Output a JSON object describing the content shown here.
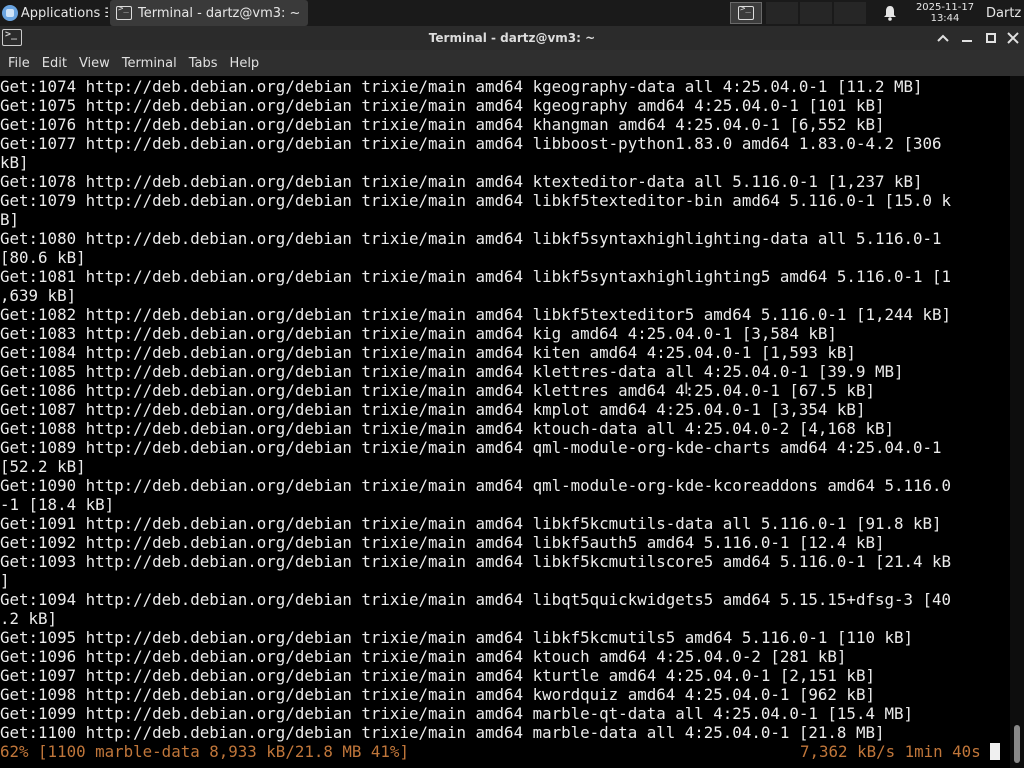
{
  "panel": {
    "apps_label": "Applications ☰",
    "task_label": "Terminal - dartz@vm3: ~",
    "clock_date": "2025-11-17",
    "clock_time": "13:44",
    "user": "Dartz",
    "icons": [
      "applications-icon",
      "terminal-icon",
      "notification-bell-icon"
    ]
  },
  "window": {
    "title": "Terminal - dartz@vm3: ~",
    "controls": [
      "chevron-up-icon",
      "minimize-icon",
      "maximize-icon",
      "close-icon"
    ]
  },
  "menu": [
    {
      "label": "File"
    },
    {
      "label": "Edit"
    },
    {
      "label": "View"
    },
    {
      "label": "Terminal"
    },
    {
      "label": "Tabs"
    },
    {
      "label": "Help"
    }
  ],
  "terminal": {
    "lines": [
      "Get:1074 http://deb.debian.org/debian trixie/main amd64 kgeography-data all 4:25.04.0-1 [11.2 MB]",
      "Get:1075 http://deb.debian.org/debian trixie/main amd64 kgeography amd64 4:25.04.0-1 [101 kB]",
      "Get:1076 http://deb.debian.org/debian trixie/main amd64 khangman amd64 4:25.04.0-1 [6,552 kB]",
      "Get:1077 http://deb.debian.org/debian trixie/main amd64 libboost-python1.83.0 amd64 1.83.0-4.2 [306",
      "kB]",
      "Get:1078 http://deb.debian.org/debian trixie/main amd64 ktexteditor-data all 5.116.0-1 [1,237 kB]",
      "Get:1079 http://deb.debian.org/debian trixie/main amd64 libkf5texteditor-bin amd64 5.116.0-1 [15.0 k",
      "B]",
      "Get:1080 http://deb.debian.org/debian trixie/main amd64 libkf5syntaxhighlighting-data all 5.116.0-1",
      "[80.6 kB]",
      "Get:1081 http://deb.debian.org/debian trixie/main amd64 libkf5syntaxhighlighting5 amd64 5.116.0-1 [1",
      ",639 kB]",
      "Get:1082 http://deb.debian.org/debian trixie/main amd64 libkf5texteditor5 amd64 5.116.0-1 [1,244 kB]",
      "Get:1083 http://deb.debian.org/debian trixie/main amd64 kig amd64 4:25.04.0-1 [3,584 kB]",
      "Get:1084 http://deb.debian.org/debian trixie/main amd64 kiten amd64 4:25.04.0-1 [1,593 kB]",
      "Get:1085 http://deb.debian.org/debian trixie/main amd64 klettres-data all 4:25.04.0-1 [39.9 MB]",
      "Get:1086 http://deb.debian.org/debian trixie/main amd64 klettres amd64 4:25.04.0-1 [67.5 kB]",
      "Get:1087 http://deb.debian.org/debian trixie/main amd64 kmplot amd64 4:25.04.0-1 [3,354 kB]",
      "Get:1088 http://deb.debian.org/debian trixie/main amd64 ktouch-data all 4:25.04.0-2 [4,168 kB]",
      "Get:1089 http://deb.debian.org/debian trixie/main amd64 qml-module-org-kde-charts amd64 4:25.04.0-1",
      "[52.2 kB]",
      "Get:1090 http://deb.debian.org/debian trixie/main amd64 qml-module-org-kde-kcoreaddons amd64 5.116.0",
      "-1 [18.4 kB]",
      "Get:1091 http://deb.debian.org/debian trixie/main amd64 libkf5kcmutils-data all 5.116.0-1 [91.8 kB]",
      "Get:1092 http://deb.debian.org/debian trixie/main amd64 libkf5auth5 amd64 5.116.0-1 [12.4 kB]",
      "Get:1093 http://deb.debian.org/debian trixie/main amd64 libkf5kcmutilscore5 amd64 5.116.0-1 [21.4 kB",
      "]",
      "Get:1094 http://deb.debian.org/debian trixie/main amd64 libqt5quickwidgets5 amd64 5.15.15+dfsg-3 [40",
      ".2 kB]",
      "Get:1095 http://deb.debian.org/debian trixie/main amd64 libkf5kcmutils5 amd64 5.116.0-1 [110 kB]",
      "Get:1096 http://deb.debian.org/debian trixie/main amd64 ktouch amd64 4:25.04.0-2 [281 kB]",
      "Get:1097 http://deb.debian.org/debian trixie/main amd64 kturtle amd64 4:25.04.0-1 [2,151 kB]",
      "Get:1098 http://deb.debian.org/debian trixie/main amd64 kwordquiz amd64 4:25.04.0-1 [962 kB]",
      "Get:1099 http://deb.debian.org/debian trixie/main amd64 marble-qt-data all 4:25.04.0-1 [15.4 MB]",
      "Get:1100 http://deb.debian.org/debian trixie/main amd64 marble-data all 4:25.04.0-1 [21.8 MB]"
    ],
    "progress_left": "62% [1100 marble-data 8,933 kB/21.8 MB 41%]",
    "progress_right": "7,362 kB/s 1min 40s",
    "progress_color": "#c0763a",
    "text_color": "#ececec",
    "background": "#000000"
  }
}
